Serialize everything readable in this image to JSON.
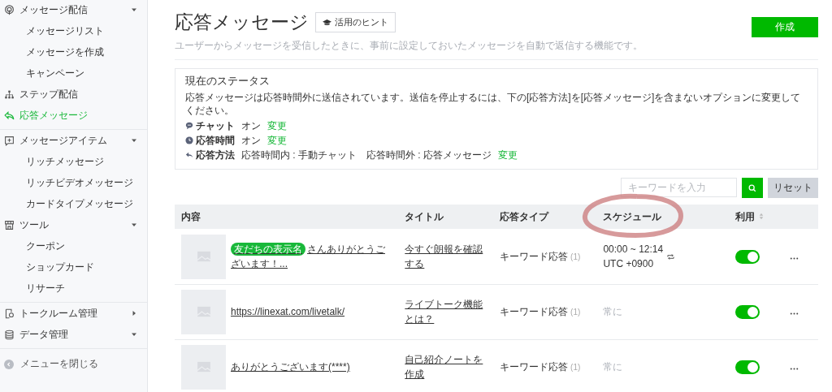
{
  "sidebar": {
    "groups": [
      {
        "items": [
          {
            "label": "メッセージ配信",
            "expanded": true,
            "selected": false,
            "children": [
              {
                "label": "メッセージリスト",
                "selected": false
              },
              {
                "label": "メッセージを作成",
                "selected": false
              },
              {
                "label": "キャンペーン",
                "selected": false
              }
            ]
          },
          {
            "label": "ステップ配信",
            "selected": false
          },
          {
            "label": "応答メッセージ",
            "selected": true
          }
        ]
      },
      {
        "items": [
          {
            "label": "メッセージアイテム",
            "expanded": true,
            "selected": false,
            "children": [
              {
                "label": "リッチメッセージ",
                "selected": false
              },
              {
                "label": "リッチビデオメッセージ",
                "selected": false
              },
              {
                "label": "カードタイプメッセージ",
                "selected": false
              }
            ]
          },
          {
            "label": "ツール",
            "expanded": true,
            "selected": false,
            "children": [
              {
                "label": "クーポン",
                "selected": false
              },
              {
                "label": "ショップカード",
                "selected": false
              },
              {
                "label": "リサーチ",
                "selected": false
              }
            ]
          }
        ]
      },
      {
        "items": [
          {
            "label": "トークルーム管理",
            "expanded": false,
            "selected": false
          },
          {
            "label": "データ管理",
            "expanded": true,
            "selected": false
          }
        ]
      }
    ],
    "collapse_label": "メニューを閉じる"
  },
  "page": {
    "title": "応答メッセージ",
    "hint_button": "活用のヒント",
    "description": "ユーザーからメッセージを受信したときに、事前に設定しておいたメッセージを自動で返信する機能です。",
    "create_button": "作成"
  },
  "status": {
    "title": "現在のステータス",
    "message": "応答メッセージは応答時間外に送信されています。送信を停止するには、下の[応答方法]を[応答メッセージ]を含まないオプションに変更してください。",
    "lines": [
      {
        "label": "チャット",
        "value": "オン",
        "link": "変更"
      },
      {
        "label": "応答時間",
        "value": "オン",
        "link": "変更"
      },
      {
        "label": "応答方法",
        "value": "応答時間内 : 手動チャット　応答時間外 : 応答メッセージ",
        "link": "変更"
      }
    ]
  },
  "search": {
    "placeholder": "キーワードを入力",
    "reset_button": "リセット"
  },
  "table": {
    "columns": [
      "内容",
      "タイトル",
      "応答タイプ",
      "スケジュール",
      "利用"
    ],
    "rows": [
      {
        "tag": "友だちの表示名",
        "content": "さんありがとうございます！...",
        "title": "今すぐ朗報を確認する",
        "type": "キーワード応答",
        "count": "(1)",
        "schedule": {
          "kind": "time",
          "lines": [
            "00:00 ~ 12:14",
            "UTC +0900"
          ]
        },
        "enabled": true
      },
      {
        "content": "https://linexat.com/livetalk/",
        "title": "ライブトーク機能とは？",
        "type": "キーワード応答",
        "count": "(1)",
        "schedule": {
          "kind": "always",
          "lines": [
            "常に"
          ]
        },
        "enabled": true
      },
      {
        "content": "ありがとうございます(****)",
        "title": "自己紹介ノートを作成",
        "type": "キーワード応答",
        "count": "(1)",
        "schedule": {
          "kind": "always",
          "lines": [
            "常に"
          ]
        },
        "enabled": true
      }
    ]
  }
}
